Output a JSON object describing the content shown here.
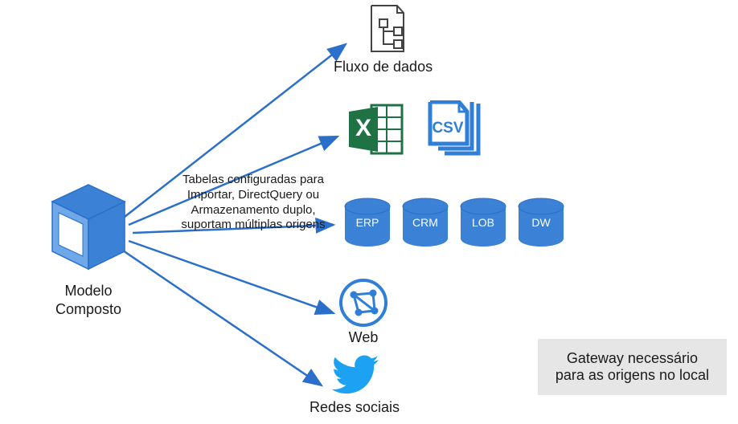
{
  "source": {
    "label": "Modelo\nComposto"
  },
  "arrows": {
    "mid_label": "Tabelas configuradas para Importar, DirectQuery ou Armazenamento duplo, suportam múltiplas origens"
  },
  "targets": {
    "dataflow": {
      "label": "Fluxo de dados"
    },
    "files": {
      "excel_icon": "Excel",
      "csv_label": "CSV"
    },
    "databases": {
      "items": [
        {
          "label": "ERP"
        },
        {
          "label": "CRM"
        },
        {
          "label": "LOB"
        },
        {
          "label": "DW"
        }
      ]
    },
    "web": {
      "label": "Web"
    },
    "social": {
      "label": "Redes sociais"
    }
  },
  "note": {
    "line1": "Gateway necessário",
    "line2": "para as origens no local"
  },
  "colors": {
    "accent": "#2f7ed8",
    "arrow": "#2a6fc9",
    "excel": "#1f7244",
    "twitter": "#1da1f2"
  }
}
